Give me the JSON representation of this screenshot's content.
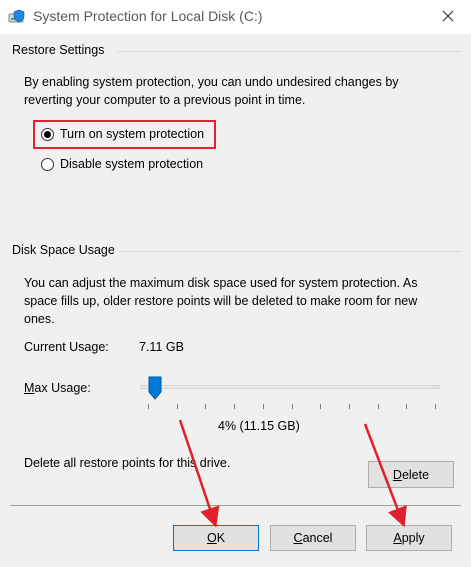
{
  "window": {
    "title": "System Protection for Local Disk (C:)"
  },
  "restore": {
    "header": "Restore Settings",
    "description": "By enabling system protection, you can undo undesired changes by reverting your computer to a previous point in time.",
    "options": [
      {
        "label": "Turn on system protection",
        "selected": true
      },
      {
        "label": "Disable system protection",
        "selected": false
      }
    ]
  },
  "disk": {
    "header": "Disk Space Usage",
    "description": "You can adjust the maximum disk space used for system protection. As space fills up, older restore points will be deleted to make room for new ones.",
    "current_usage_label": "Current Usage:",
    "current_usage_value": "7.11 GB",
    "max_usage_label": "Max Usage:",
    "slider_percent": 4,
    "max_usage_value": "4% (11.15 GB)",
    "delete_text": "Delete all restore points for this drive.",
    "delete_button": "Delete"
  },
  "buttons": {
    "ok": "OK",
    "cancel": "Cancel",
    "apply": "Apply"
  },
  "colors": {
    "highlight": "#e0202a",
    "arrow": "#e0202a",
    "slider_thumb": "#0078d7"
  },
  "icons": {
    "title": "drive-shield-icon",
    "close": "close-icon"
  }
}
